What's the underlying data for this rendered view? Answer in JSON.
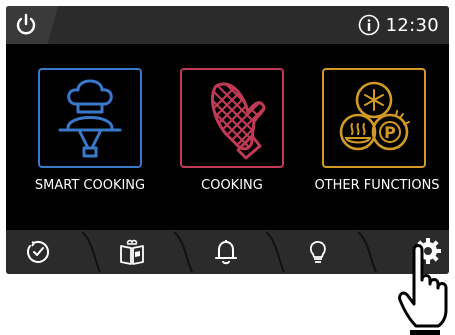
{
  "status": {
    "time": "12:30"
  },
  "main_menu": [
    {
      "label": "SMART COOKING",
      "color": "#3a78c9",
      "icon": "chef-cloche-icon"
    },
    {
      "label": "COOKING",
      "color": "#c03a55",
      "icon": "oven-mitt-icon"
    },
    {
      "label": "OTHER FUNCTIONS",
      "color": "#d29a24",
      "icon": "functions-icon"
    }
  ],
  "bottom_bar": [
    "timer-icon",
    "recipe-book-icon",
    "bell-icon",
    "light-bulb-icon",
    "settings-gear-icon"
  ]
}
